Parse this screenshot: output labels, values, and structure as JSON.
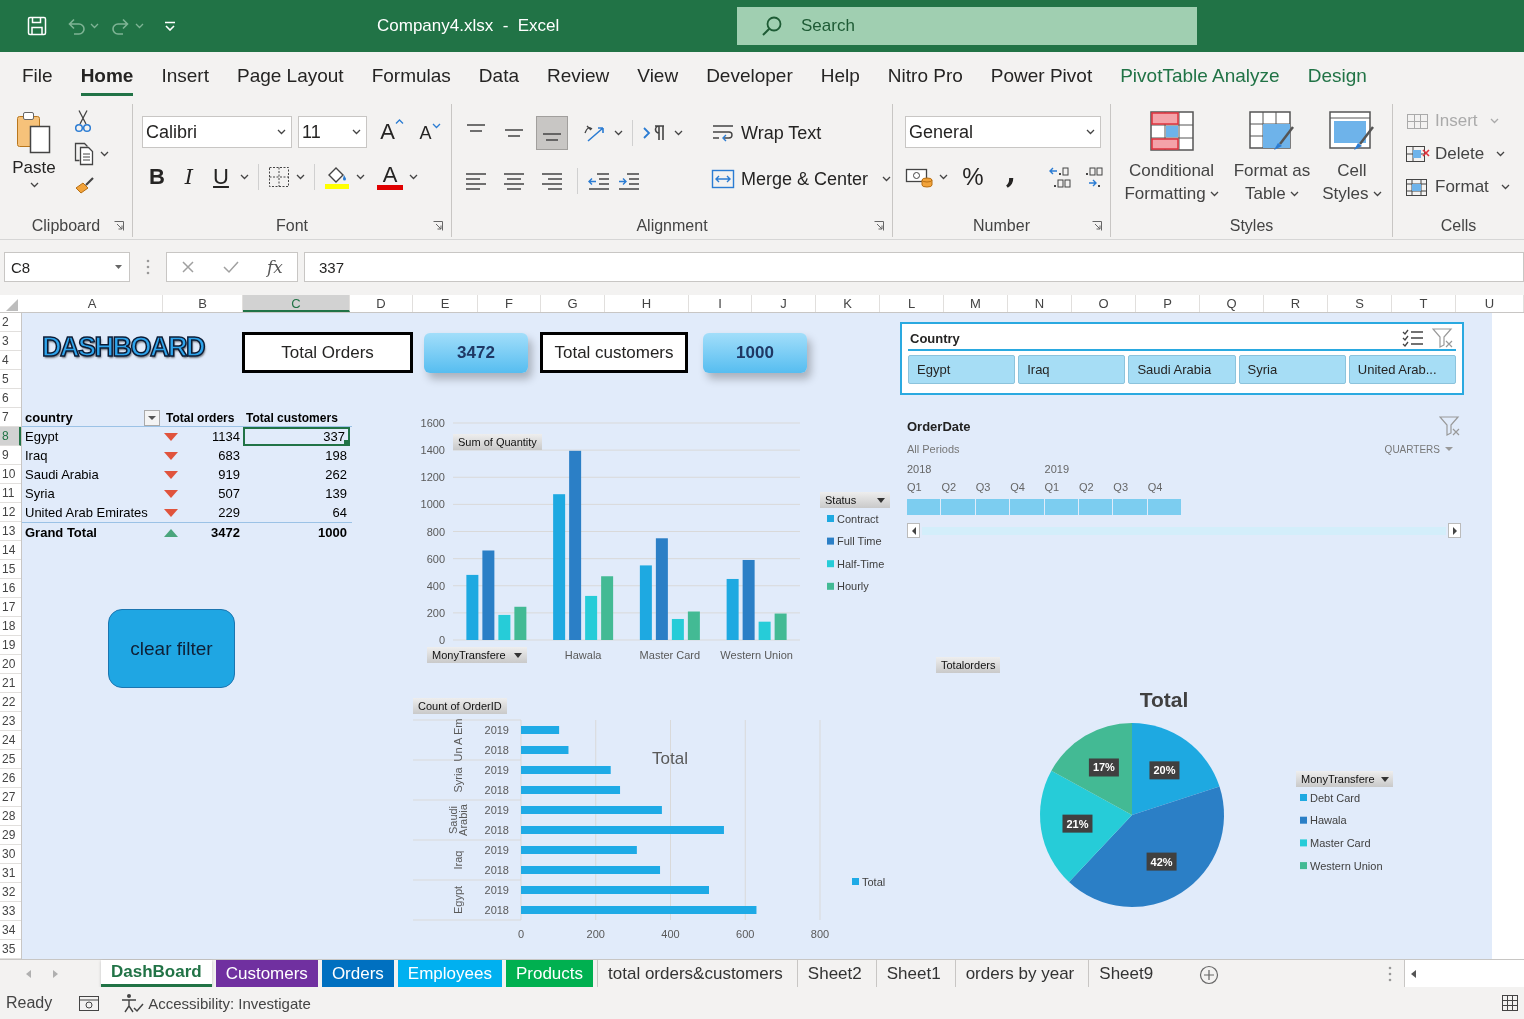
{
  "window": {
    "title": "Company4.xlsx  -  Excel",
    "search": {
      "placeholder": "Search"
    }
  },
  "menu_tabs": [
    {
      "label": "File",
      "selected": false,
      "kind": "standard"
    },
    {
      "label": "Home",
      "selected": true,
      "kind": "standard"
    },
    {
      "label": "Insert",
      "selected": false,
      "kind": "standard"
    },
    {
      "label": "Page Layout",
      "selected": false,
      "kind": "standard"
    },
    {
      "label": "Formulas",
      "selected": false,
      "kind": "standard"
    },
    {
      "label": "Data",
      "selected": false,
      "kind": "standard"
    },
    {
      "label": "Review",
      "selected": false,
      "kind": "standard"
    },
    {
      "label": "View",
      "selected": false,
      "kind": "standard"
    },
    {
      "label": "Developer",
      "selected": false,
      "kind": "standard"
    },
    {
      "label": "Help",
      "selected": false,
      "kind": "standard"
    },
    {
      "label": "Nitro Pro",
      "selected": false,
      "kind": "standard"
    },
    {
      "label": "Power Pivot",
      "selected": false,
      "kind": "standard"
    },
    {
      "label": "PivotTable Analyze",
      "selected": false,
      "kind": "contextual"
    },
    {
      "label": "Design",
      "selected": false,
      "kind": "contextual"
    }
  ],
  "ribbon": {
    "groups": [
      {
        "kind": "clipboard",
        "label": "Clipboard",
        "launcher": true,
        "paste": "Paste"
      },
      {
        "kind": "font",
        "label": "Font",
        "launcher": true,
        "font_name": "Calibri",
        "font_size": "11",
        "grow": "A",
        "shrink": "A",
        "bold": "B",
        "italic": "I",
        "underline": "U",
        "font_color": "A"
      },
      {
        "kind": "alignment",
        "label": "Alignment",
        "launcher": true,
        "vertical_align": [
          {
            "selected": false
          },
          {
            "selected": false
          },
          {
            "selected": true
          }
        ],
        "horizontal_align": [
          {
            "selected": false
          },
          {
            "selected": false
          },
          {
            "selected": false
          }
        ],
        "wrap_text": "Wrap Text",
        "merge": "Merge & Center"
      },
      {
        "kind": "number",
        "label": "Number",
        "launcher": true,
        "format": "General",
        "percent": "%",
        "comma": ","
      },
      {
        "kind": "styles",
        "label": "Styles",
        "buttons": [
          "Conditional Formatting",
          "Format as Table",
          "Cell Styles"
        ]
      },
      {
        "kind": "cells",
        "label": "Cells",
        "buttons": [
          {
            "label": "Insert",
            "disabled": true
          },
          {
            "label": "Delete",
            "disabled": false
          },
          {
            "label": "Format",
            "disabled": false
          }
        ]
      }
    ]
  },
  "formula_bar": {
    "name_box": "C8",
    "function_label": "fx",
    "formula": "337"
  },
  "sheet": {
    "columns": [
      {
        "label": "A",
        "selected": false
      },
      {
        "label": "B",
        "selected": false
      },
      {
        "label": "C",
        "selected": true
      },
      {
        "label": "D",
        "selected": false
      },
      {
        "label": "E",
        "selected": false
      },
      {
        "label": "F",
        "selected": false
      },
      {
        "label": "G",
        "selected": false
      },
      {
        "label": "H",
        "selected": false
      },
      {
        "label": "I",
        "selected": false
      },
      {
        "label": "J",
        "selected": false
      },
      {
        "label": "K",
        "selected": false
      },
      {
        "label": "L",
        "selected": false
      },
      {
        "label": "M",
        "selected": false
      },
      {
        "label": "N",
        "selected": false
      },
      {
        "label": "O",
        "selected": false
      },
      {
        "label": "P",
        "selected": false
      },
      {
        "label": "Q",
        "selected": false
      },
      {
        "label": "R",
        "selected": false
      },
      {
        "label": "S",
        "selected": false
      },
      {
        "label": "T",
        "selected": false
      },
      {
        "label": "U",
        "selected": false
      }
    ],
    "rows": [
      {
        "label": "2",
        "selected": false
      },
      {
        "label": "3",
        "selected": false
      },
      {
        "label": "4",
        "selected": false
      },
      {
        "label": "5",
        "selected": false
      },
      {
        "label": "6",
        "selected": false
      },
      {
        "label": "7",
        "selected": false
      },
      {
        "label": "8",
        "selected": true
      },
      {
        "label": "9",
        "selected": false
      },
      {
        "label": "10",
        "selected": false
      },
      {
        "label": "11",
        "selected": false
      },
      {
        "label": "12",
        "selected": false
      },
      {
        "label": "13",
        "selected": false
      },
      {
        "label": "14",
        "selected": false
      },
      {
        "label": "15",
        "selected": false
      },
      {
        "label": "16",
        "selected": false
      },
      {
        "label": "17",
        "selected": false
      },
      {
        "label": "18",
        "selected": false
      },
      {
        "label": "19",
        "selected": false
      },
      {
        "label": "20",
        "selected": false
      },
      {
        "label": "21",
        "selected": false
      },
      {
        "label": "22",
        "selected": false
      },
      {
        "label": "23",
        "selected": false
      },
      {
        "label": "24",
        "selected": false
      },
      {
        "label": "25",
        "selected": false
      },
      {
        "label": "26",
        "selected": false
      },
      {
        "label": "27",
        "selected": false
      },
      {
        "label": "28",
        "selected": false
      },
      {
        "label": "29",
        "selected": false
      },
      {
        "label": "30",
        "selected": false
      },
      {
        "label": "31",
        "selected": false
      },
      {
        "label": "32",
        "selected": false
      },
      {
        "label": "33",
        "selected": false
      },
      {
        "label": "34",
        "selected": false
      },
      {
        "label": "35",
        "selected": false
      }
    ],
    "title_art": "DASHBOARD",
    "kpis": [
      {
        "kind": "label",
        "text": "Total Orders"
      },
      {
        "kind": "value",
        "text": "3472"
      },
      {
        "kind": "label",
        "text": "Total customers"
      },
      {
        "kind": "value",
        "text": "1000"
      }
    ],
    "pivot": {
      "headers": [
        "country",
        "Total orders",
        "Total customers"
      ],
      "rows": [
        {
          "kind": "data",
          "country": "Egypt",
          "trend_up": false,
          "orders": "1134",
          "customers": "337",
          "selected": true
        },
        {
          "kind": "data",
          "country": "Iraq",
          "trend_up": false,
          "orders": "683",
          "customers": "198",
          "selected": false
        },
        {
          "kind": "data",
          "country": "Saudi Arabia",
          "trend_up": false,
          "orders": "919",
          "customers": "262",
          "selected": false
        },
        {
          "kind": "data",
          "country": "Syria",
          "trend_up": false,
          "orders": "507",
          "customers": "139",
          "selected": false
        },
        {
          "kind": "data",
          "country": "United Arab Emirates",
          "trend_up": false,
          "orders": "229",
          "customers": "64",
          "selected": false
        },
        {
          "kind": "total",
          "country": "Grand Total",
          "trend_up": true,
          "orders": "3472",
          "customers": "1000",
          "selected": false
        }
      ]
    },
    "clear_filter": "clear filter",
    "country_slicer": {
      "title": "Country",
      "items": [
        {
          "label": "Egypt",
          "selected": true
        },
        {
          "label": "Iraq",
          "selected": true
        },
        {
          "label": "Saudi Arabia",
          "selected": true
        },
        {
          "label": "Syria",
          "selected": true
        },
        {
          "label": "United Arab...",
          "selected": true
        }
      ]
    },
    "timeline": {
      "title": "OrderDate",
      "range_label": "All Periods",
      "level": "QUARTERS",
      "years": [
        {
          "label": "2018",
          "quarters": [
            {
              "label": "Q1",
              "selected": true
            },
            {
              "label": "Q2",
              "selected": true
            },
            {
              "label": "Q3",
              "selected": true
            },
            {
              "label": "Q4",
              "selected": true
            }
          ]
        },
        {
          "label": "2019",
          "quarters": [
            {
              "label": "Q1",
              "selected": true
            },
            {
              "label": "Q2",
              "selected": true
            },
            {
              "label": "Q3",
              "selected": true
            },
            {
              "label": "Q4",
              "selected": true
            }
          ]
        }
      ]
    },
    "column_chart": {
      "field_buttons": [
        {
          "kind": "value",
          "label": "Sum of Quantity"
        },
        {
          "kind": "axis",
          "label": "MonyTransfere"
        },
        {
          "kind": "legend",
          "label": "Status"
        }
      ],
      "chart_data": {
        "type": "bar",
        "grid": true,
        "legend": "right",
        "categories": [
          null,
          "Hawala",
          "Master Card",
          "Western Union"
        ],
        "ylim": [
          0,
          1600
        ],
        "yticks": [
          0,
          200,
          400,
          600,
          800,
          1000,
          1200,
          1400,
          1600
        ],
        "series": [
          {
            "name": "Contract",
            "color": "#1ea9e1",
            "values": [
              480,
              1075,
              550,
              450
            ]
          },
          {
            "name": "Full Time",
            "color": "#2b7fc6",
            "values": [
              660,
              1395,
              750,
              590
            ]
          },
          {
            "name": "Half-Time",
            "color": "#26ccd8",
            "values": [
              185,
              325,
              155,
              135
            ]
          },
          {
            "name": "Hourly",
            "color": "#43ba94",
            "values": [
              245,
              470,
              210,
              195
            ]
          }
        ]
      }
    },
    "bar_chart": {
      "field_buttons": [
        {
          "kind": "value",
          "label": "Count of OrderID"
        }
      ],
      "group_labels": [
        "Un A Em",
        "Syria",
        "Saudi Arabia",
        "Iraq",
        "Egypt"
      ],
      "chart_data": {
        "type": "bar",
        "orientation": "horizontal",
        "grid": true,
        "legend": "right",
        "title": "Total",
        "categories": [
          "2019",
          "2018",
          "2019",
          "2018",
          "2019",
          "2018",
          "2019",
          "2018",
          "2019",
          "2018"
        ],
        "xlim": [
          0,
          800
        ],
        "xticks": [
          0,
          200,
          400,
          600,
          800
        ],
        "series": [
          {
            "name": "Total",
            "color": "#1eaae6",
            "values": [
              102,
              127,
              240,
              265,
              377,
              543,
              310,
              372,
              503,
              630
            ]
          }
        ]
      }
    },
    "pie_chart": {
      "field_buttons": [
        {
          "kind": "value",
          "label": "Totalorders"
        },
        {
          "kind": "legend",
          "label": "MonyTransfere"
        }
      ],
      "legend": [
        {
          "color": "#1ea9e1"
        },
        {
          "color": "#2b7fc6"
        },
        {
          "color": "#26ccd8"
        },
        {
          "color": "#43ba94"
        }
      ],
      "chart_data": {
        "type": "pie",
        "legend": "right",
        "title": "Total",
        "categories": [
          "Debt Card",
          "Hawala",
          "Master Card",
          "Western Union"
        ],
        "series": [
          {
            "values": [
              20,
              42,
              21,
              17
            ]
          }
        ],
        "value_labels": [
          "20%",
          "42%",
          "21%",
          "17%"
        ]
      }
    }
  },
  "sheet_tabs": [
    {
      "label": "DashBoard",
      "selected": true
    },
    {
      "label": "Customers",
      "selected": false,
      "color": "#7030a0"
    },
    {
      "label": "Orders",
      "selected": false,
      "color": "#0070c0"
    },
    {
      "label": "Employees",
      "selected": false,
      "color": "#00b0f0"
    },
    {
      "label": "Products",
      "selected": false,
      "color": "#00b050"
    },
    {
      "label": "total orders&customers",
      "selected": false
    },
    {
      "label": "Sheet2",
      "selected": false
    },
    {
      "label": "Sheet1",
      "selected": false
    },
    {
      "label": "orders by year",
      "selected": false
    },
    {
      "label": "Sheet9",
      "selected": false
    }
  ],
  "status_bar": {
    "mode": "Ready",
    "accessibility": "Accessibility: Investigate"
  }
}
